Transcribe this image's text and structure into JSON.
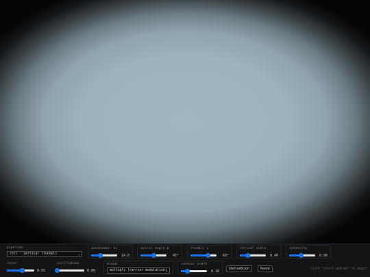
{
  "controls": {
    "pipeline": {
      "label": "pipeline",
      "value": "roll · vertical (funnel)"
    },
    "wavenumber": {
      "label": "wavenumber k₀",
      "value": "14.0",
      "level": 0.35
    },
    "spiral_angle": {
      "label": "spiral angle φ",
      "value": "45°",
      "level": 0.5
    },
    "rhombic": {
      "label": "rhombic γ",
      "value": "60°",
      "level": 0.67
    },
    "retinal_scale": {
      "label": "retinal scale",
      "value": "0.40",
      "level": 0.3
    },
    "intensity": {
      "label": "intensity",
      "value": "0.90",
      "level": 0.45
    },
    "color": {
      "label": "color",
      "value": "0.55",
      "level": 0.55
    },
    "oscillation": {
      "label": "oscillation",
      "value": "0.00",
      "level": 0.0
    },
    "blend": {
      "label": "blend",
      "value": "multiply (carrier modulation)"
    },
    "contour_width": {
      "label": "contour width",
      "value": "0.18",
      "level": 0.25
    }
  },
  "buttons": {
    "start_webcam": "start webcam",
    "freeze": "freeze"
  },
  "status_hint": "click \"start webcam\" to begin",
  "colors": {
    "accent": "#1a73e8",
    "panel": "#121416"
  }
}
